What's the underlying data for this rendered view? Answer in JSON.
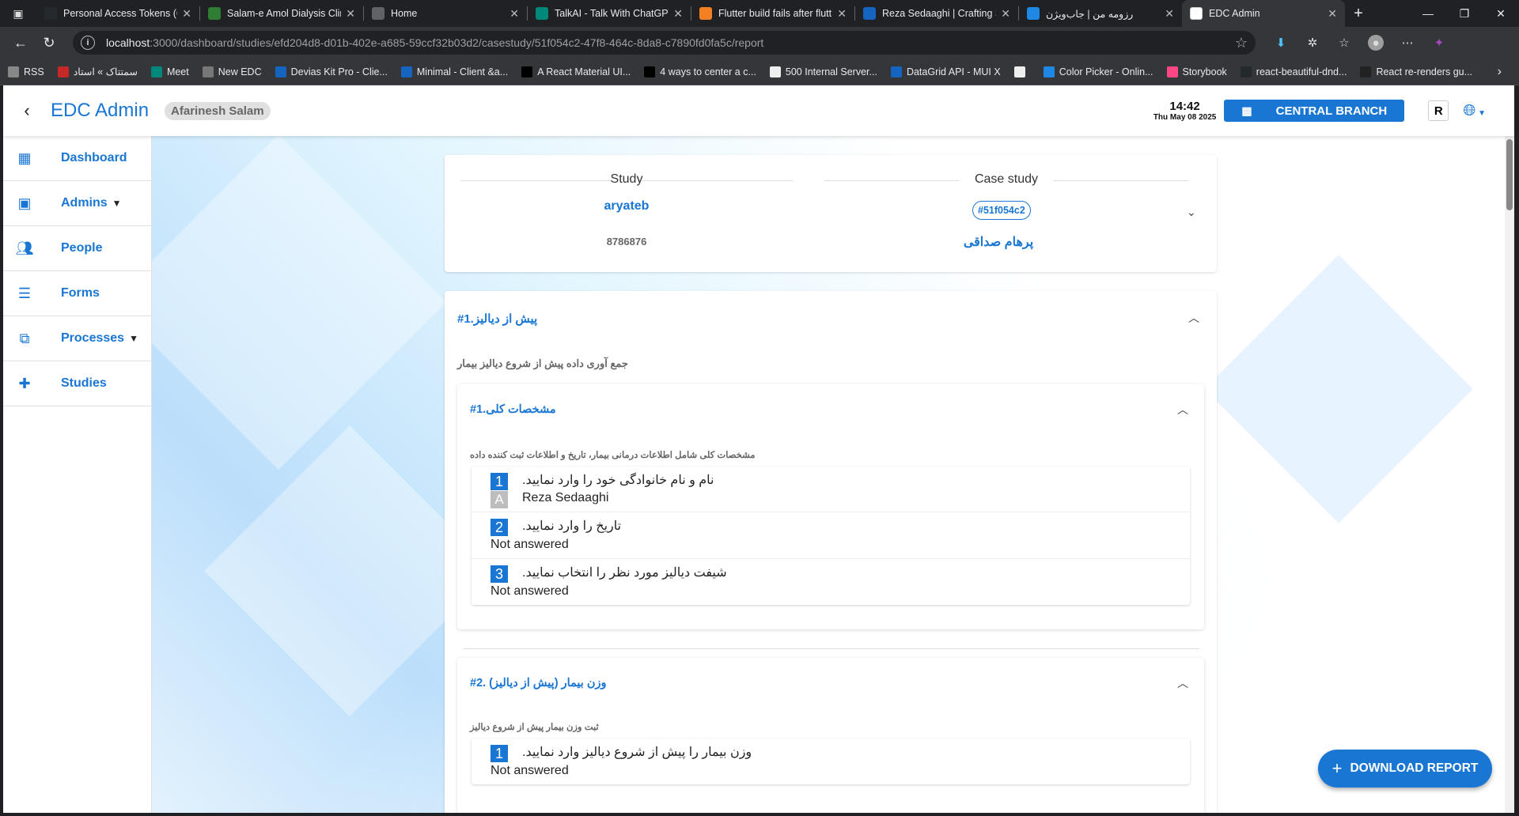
{
  "browser": {
    "tabs": [
      {
        "title": "Personal Access Tokens (Cla",
        "icon": "github-icon",
        "color": "#24292e"
      },
      {
        "title": "Salam-e Amol Dialysis Clinic",
        "icon": "clinic-icon",
        "color": "#2e7d32"
      },
      {
        "title": "Home",
        "icon": "home-icon",
        "color": "#5f6368"
      },
      {
        "title": "TalkAI - Talk With ChatGPT",
        "icon": "talkai-icon",
        "color": "#00897b"
      },
      {
        "title": "Flutter build fails after flutt",
        "icon": "stackoverflow-icon",
        "color": "#f48024"
      },
      {
        "title": "Reza Sedaaghi | Crafting Sc",
        "icon": "rs-icon",
        "color": "#1565c0"
      },
      {
        "title": "رزومه من | جاب‌ویژن",
        "icon": "jobvision-icon",
        "color": "#1e88e5"
      },
      {
        "title": "EDC Admin",
        "icon": "edc-icon",
        "color": "#ffffff",
        "active": true
      }
    ],
    "url_host": "localhost",
    "url_rest": ":3000/dashboard/studies/efd204d8-d01b-402e-a685-59ccf32b03d2/casestudy/51f054c2-47f8-464c-8da8-c7890fd0fa5c/report",
    "bookmarks": [
      {
        "label": "RSS",
        "color": "#888"
      },
      {
        "label": "سمتتاک » استاد",
        "color": "#c62828"
      },
      {
        "label": "Meet",
        "color": "#00897b"
      },
      {
        "label": "New EDC",
        "color": "#777"
      },
      {
        "label": "Devias Kit Pro - Clie...",
        "color": "#1565c0"
      },
      {
        "label": "Minimal - Client &a...",
        "color": "#1565c0"
      },
      {
        "label": "A React Material UI...",
        "color": "#000"
      },
      {
        "label": "4 ways to center a c...",
        "color": "#000"
      },
      {
        "label": "500 Internal Server...",
        "color": "#eee"
      },
      {
        "label": "DataGrid API - MUI X",
        "color": "#1565c0"
      },
      {
        "label": "",
        "color": "#eee"
      },
      {
        "label": "Color Picker - Onlin...",
        "color": "#1e88e5"
      },
      {
        "label": "Storybook",
        "color": "#ff4785"
      },
      {
        "label": "react-beautiful-dnd...",
        "color": "#24292e"
      },
      {
        "label": "React re-renders gu...",
        "color": "#222"
      }
    ]
  },
  "appbar": {
    "brand": "EDC Admin",
    "user": "Afarinesh Salam",
    "time": "14:42",
    "date": "Thu May 08 2025",
    "branch": "CENTRAL BRANCH",
    "r_label": "R"
  },
  "sidebar": {
    "items": [
      {
        "label": "Dashboard",
        "icon": "dashboard-icon",
        "caret": false
      },
      {
        "label": "Admins",
        "icon": "admins-icon",
        "caret": true
      },
      {
        "label": "People",
        "icon": "people-icon",
        "caret": false
      },
      {
        "label": "Forms",
        "icon": "forms-icon",
        "caret": false
      },
      {
        "label": "Processes",
        "icon": "processes-icon",
        "caret": true
      },
      {
        "label": "Studies",
        "icon": "studies-icon",
        "caret": false
      }
    ]
  },
  "header_card": {
    "study_label": "Study",
    "case_label": "Case study",
    "study_name": "aryateb",
    "study_code": "8786876",
    "case_id": "#51f054c2",
    "case_name": "پرهام صداقی"
  },
  "section": {
    "title": "#1.پیش از دیالیز",
    "description": "جمع آوری داده پیش از شروع دیالیز بیمار",
    "subsections": [
      {
        "title": "#1.مشخصات کلی",
        "description": "مشخصات کلی شامل اطلاعات درمانی بیمار، تاریخ و اطلاعات ثبت کننده داده",
        "questions": [
          {
            "num": "1",
            "text": ".نام و نام خانوادگی خود را وارد نمایید",
            "answer_mark": "A",
            "answer": "Reza Sedaaghi"
          },
          {
            "num": "2",
            "text": ".تاریخ را وارد نمایید",
            "answer": "Not answered"
          },
          {
            "num": "3",
            "text": ".شیفت دیالیز مورد نظر را انتخاب نمایید",
            "answer": "Not answered"
          }
        ]
      },
      {
        "title": "#2. (پیش از دیالیز) وزن بیمار",
        "description": "ثبت وزن بیمار پیش از شروع دیالیز",
        "questions": [
          {
            "num": "1",
            "text": ".وزن بیمار را پیش از شروع دیالیز وارد نمایید",
            "answer": "Not answered"
          }
        ]
      }
    ]
  },
  "download_button": "DOWNLOAD REPORT",
  "colors": {
    "primary": "#1976d2",
    "text_muted": "#666666"
  }
}
